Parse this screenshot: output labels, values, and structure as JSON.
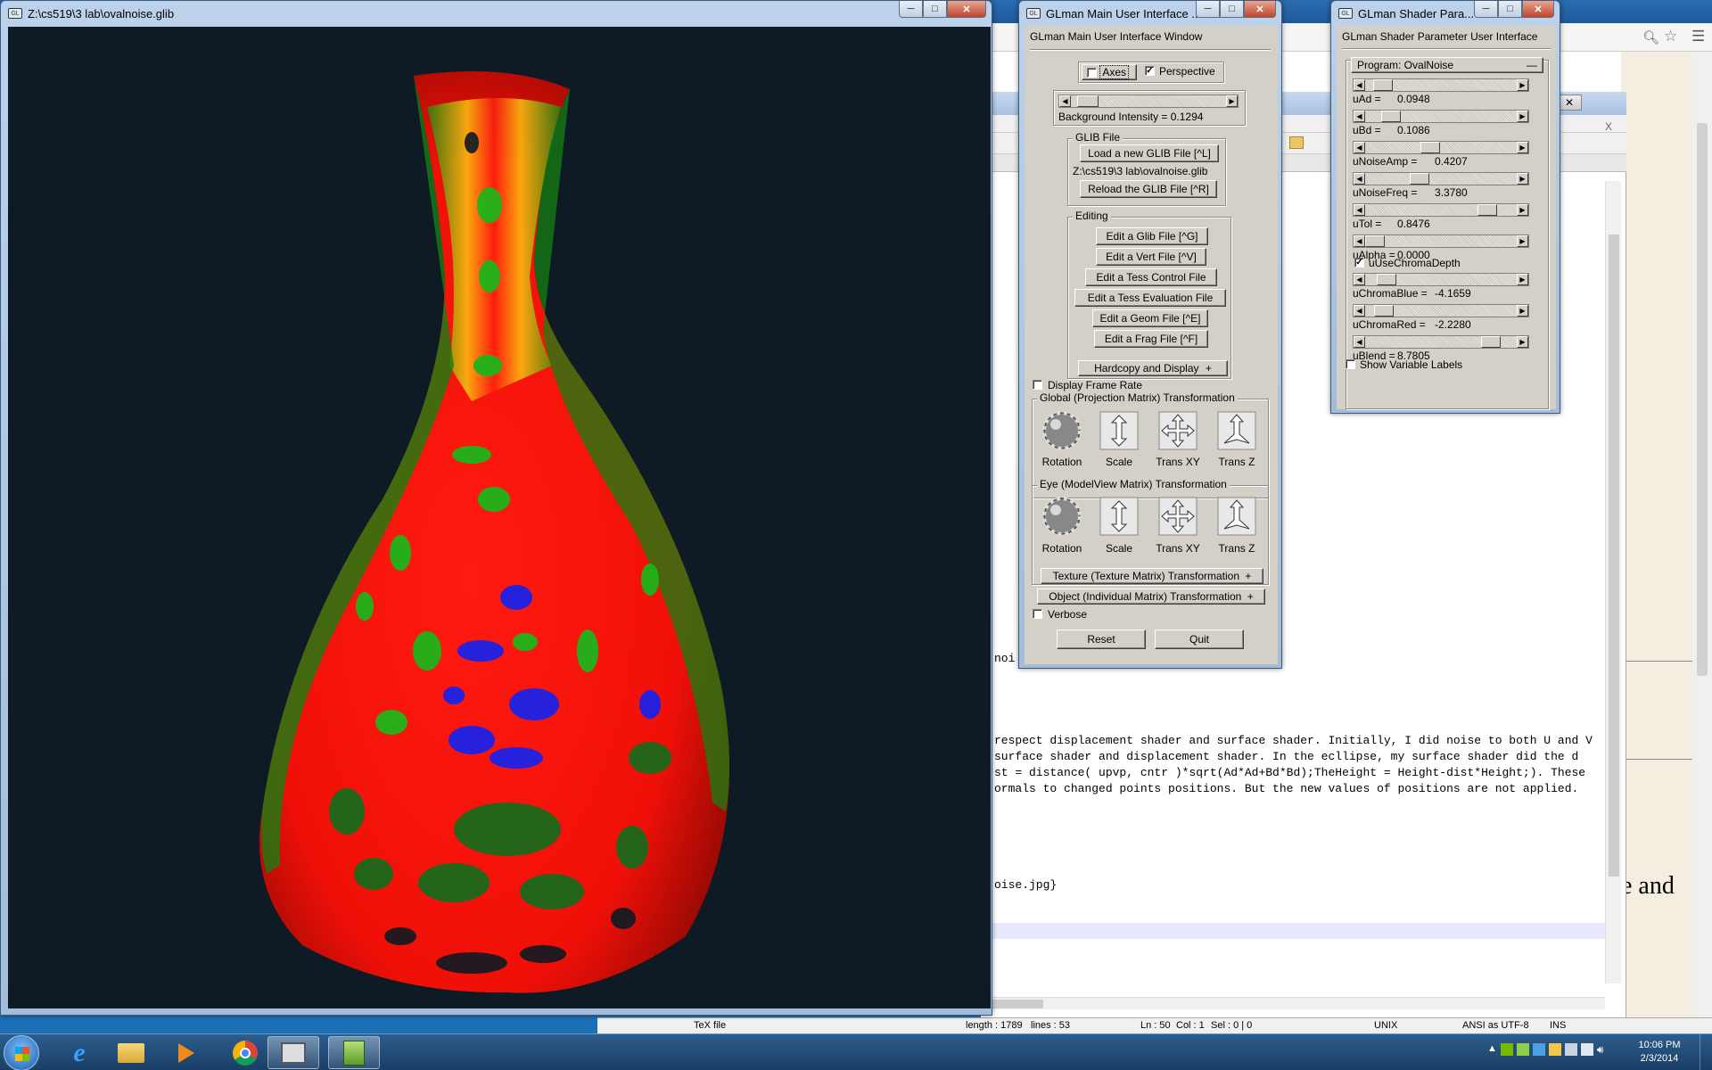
{
  "background_window": {
    "browser_tab_text": "...",
    "editor_lines": [
      "respect displacement shader and surface shader. Initially, I did noise to both U and V",
      "surface shader and displacement shader. In the ecllipse, my surface shader did the d",
      "st = distance( upvp, cntr )*sqrt(Ad*Ad+Bd*Bd);TheHeight = Height-dist*Height;). These",
      "ormals to changed points positions. But the new values of positions are not applied."
    ],
    "editor_fragment_noi": "noi",
    "editor_fragment_jpg": "oise.jpg}",
    "right_doc_text": "e and",
    "status": {
      "file_type": "TeX file",
      "length": "length : 1789",
      "lines": "lines : 53",
      "ln": "Ln : 50",
      "col": "Col : 1",
      "sel": "Sel : 0 | 0",
      "eol": "UNIX",
      "encoding": "ANSI as UTF-8",
      "ins": "INS"
    }
  },
  "viewer": {
    "title": "Z:\\cs519\\3 lab\\ovalnoise.glib",
    "background_color": "#0e1a24"
  },
  "main_ui": {
    "title": "GLman Main User Interface ...",
    "header": "GLman Main User Interface Window",
    "axes_label": "Axes",
    "axes_checked": false,
    "perspective_label": "Perspective",
    "perspective_checked": true,
    "background_intensity": "Background Intensity = 0.1294",
    "background_intensity_value": 0.1294,
    "glib_group": "GLIB File",
    "load_btn": "Load a new GLIB File [^L]",
    "glib_path": "Z:\\cs519\\3 lab\\ovalnoise.glib",
    "reload_btn": "Reload the GLIB File [^R]",
    "editing_group": "Editing",
    "edit_glib": "Edit a Glib File [^G]",
    "edit_vert": "Edit a Vert File [^V]",
    "edit_tess_control": "Edit a Tess Control File",
    "edit_tess_eval": "Edit a Tess Evaluation File",
    "edit_geom": "Edit a Geom File [^E]",
    "edit_frag": "Edit a Frag File [^F]",
    "hardcopy": "Hardcopy and Display",
    "display_frame_rate": "Display Frame Rate",
    "global_group": "Global (Projection Matrix) Transformation",
    "eye_group": "Eye (ModelView Matrix) Transformation",
    "ctrl_rotation": "Rotation",
    "ctrl_scale": "Scale",
    "ctrl_transxy": "Trans XY",
    "ctrl_transz": "Trans Z",
    "texture_btn": "Texture (Texture Matrix) Transformation",
    "object_btn": "Object (Individual Matrix) Transformation",
    "verbose": "Verbose",
    "reset": "Reset",
    "quit": "Quit",
    "plus": "+"
  },
  "shader_ui": {
    "title": "GLman Shader Para...",
    "header": "GLman Shader Parameter User Interface",
    "program": "Program: OvalNoise",
    "minus": "—",
    "params": [
      {
        "label": "uAd =",
        "value": "0.0948",
        "fraction": 0.06
      },
      {
        "label": "uBd =",
        "value": "0.1086",
        "fraction": 0.12
      },
      {
        "label": "uNoiseAmp =",
        "value": "0.4207",
        "fraction": 0.42
      },
      {
        "label": "uNoiseFreq =",
        "value": "3.3780",
        "fraction": 0.34
      },
      {
        "label": "uTol =",
        "value": "0.8476",
        "fraction": 0.85
      },
      {
        "label": "uAlpha =",
        "value": "0.0000",
        "fraction": 0.0
      }
    ],
    "use_chroma": "uUseChromaDepth",
    "use_chroma_checked": true,
    "params2": [
      {
        "label": "uChromaBlue =",
        "value": "-4.1659",
        "fraction": 0.09
      },
      {
        "label": "uChromaRed =",
        "value": "-2.2280",
        "fraction": 0.07
      },
      {
        "label": "uBlend =",
        "value": "8.7805",
        "fraction": 0.88
      }
    ],
    "show_labels": "Show Variable Labels"
  },
  "taskbar": {
    "time": "10:06 PM",
    "date": "2/3/2014"
  }
}
